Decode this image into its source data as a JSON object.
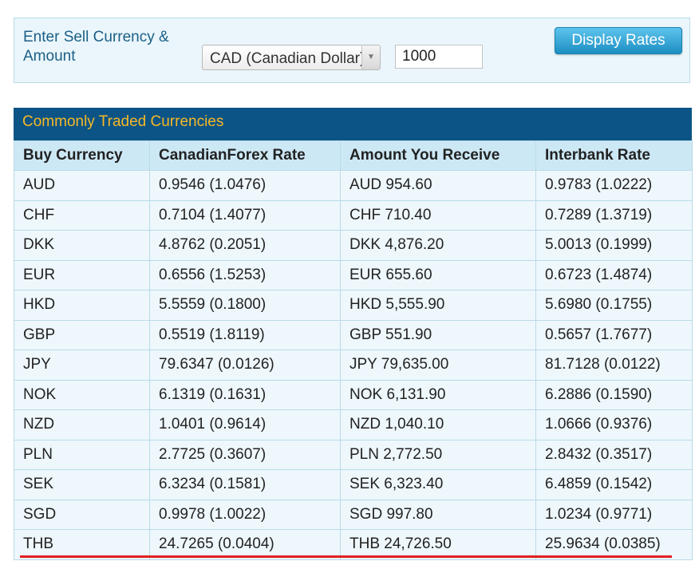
{
  "form": {
    "label": "Enter Sell Currency & Amount",
    "currency_select_value": "CAD (Canadian Dollar)",
    "amount_value": "1000",
    "display_button_label": "Display Rates"
  },
  "table": {
    "title": "Commonly Traded Currencies",
    "headers": [
      "Buy Currency",
      "CanadianForex Rate",
      "Amount You Receive",
      "Interbank Rate"
    ],
    "rows": [
      [
        "AUD",
        "0.9546 (1.0476)",
        "AUD 954.60",
        "0.9783 (1.0222)"
      ],
      [
        "CHF",
        "0.7104 (1.4077)",
        "CHF 710.40",
        "0.7289 (1.3719)"
      ],
      [
        "DKK",
        "4.8762 (0.2051)",
        "DKK 4,876.20",
        "5.0013 (0.1999)"
      ],
      [
        "EUR",
        "0.6556 (1.5253)",
        "EUR 655.60",
        "0.6723 (1.4874)"
      ],
      [
        "HKD",
        "5.5559 (0.1800)",
        "HKD 5,555.90",
        "5.6980 (0.1755)"
      ],
      [
        "GBP",
        "0.5519 (1.8119)",
        "GBP 551.90",
        "0.5657 (1.7677)"
      ],
      [
        "JPY",
        "79.6347 (0.0126)",
        "JPY 79,635.00",
        "81.7128 (0.0122)"
      ],
      [
        "NOK",
        "6.1319 (0.1631)",
        "NOK 6,131.90",
        "6.2886 (0.1590)"
      ],
      [
        "NZD",
        "1.0401 (0.9614)",
        "NZD 1,040.10",
        "1.0666 (0.9376)"
      ],
      [
        "PLN",
        "2.7725 (0.3607)",
        "PLN 2,772.50",
        "2.8432 (0.3517)"
      ],
      [
        "SEK",
        "6.3234 (0.1581)",
        "SEK 6,323.40",
        "6.4859 (0.1542)"
      ],
      [
        "SGD",
        "0.9978 (1.0022)",
        "SGD 997.80",
        "1.0234 (0.9771)"
      ],
      [
        "THB",
        "24.7265 (0.0404)",
        "THB 24,726.50",
        "25.9634 (0.0385)"
      ]
    ]
  },
  "colors": {
    "header_bar": "#0c5485",
    "header_title": "#f5b827",
    "button": "#2ea3d6",
    "highlight_underline": "#e02020"
  }
}
